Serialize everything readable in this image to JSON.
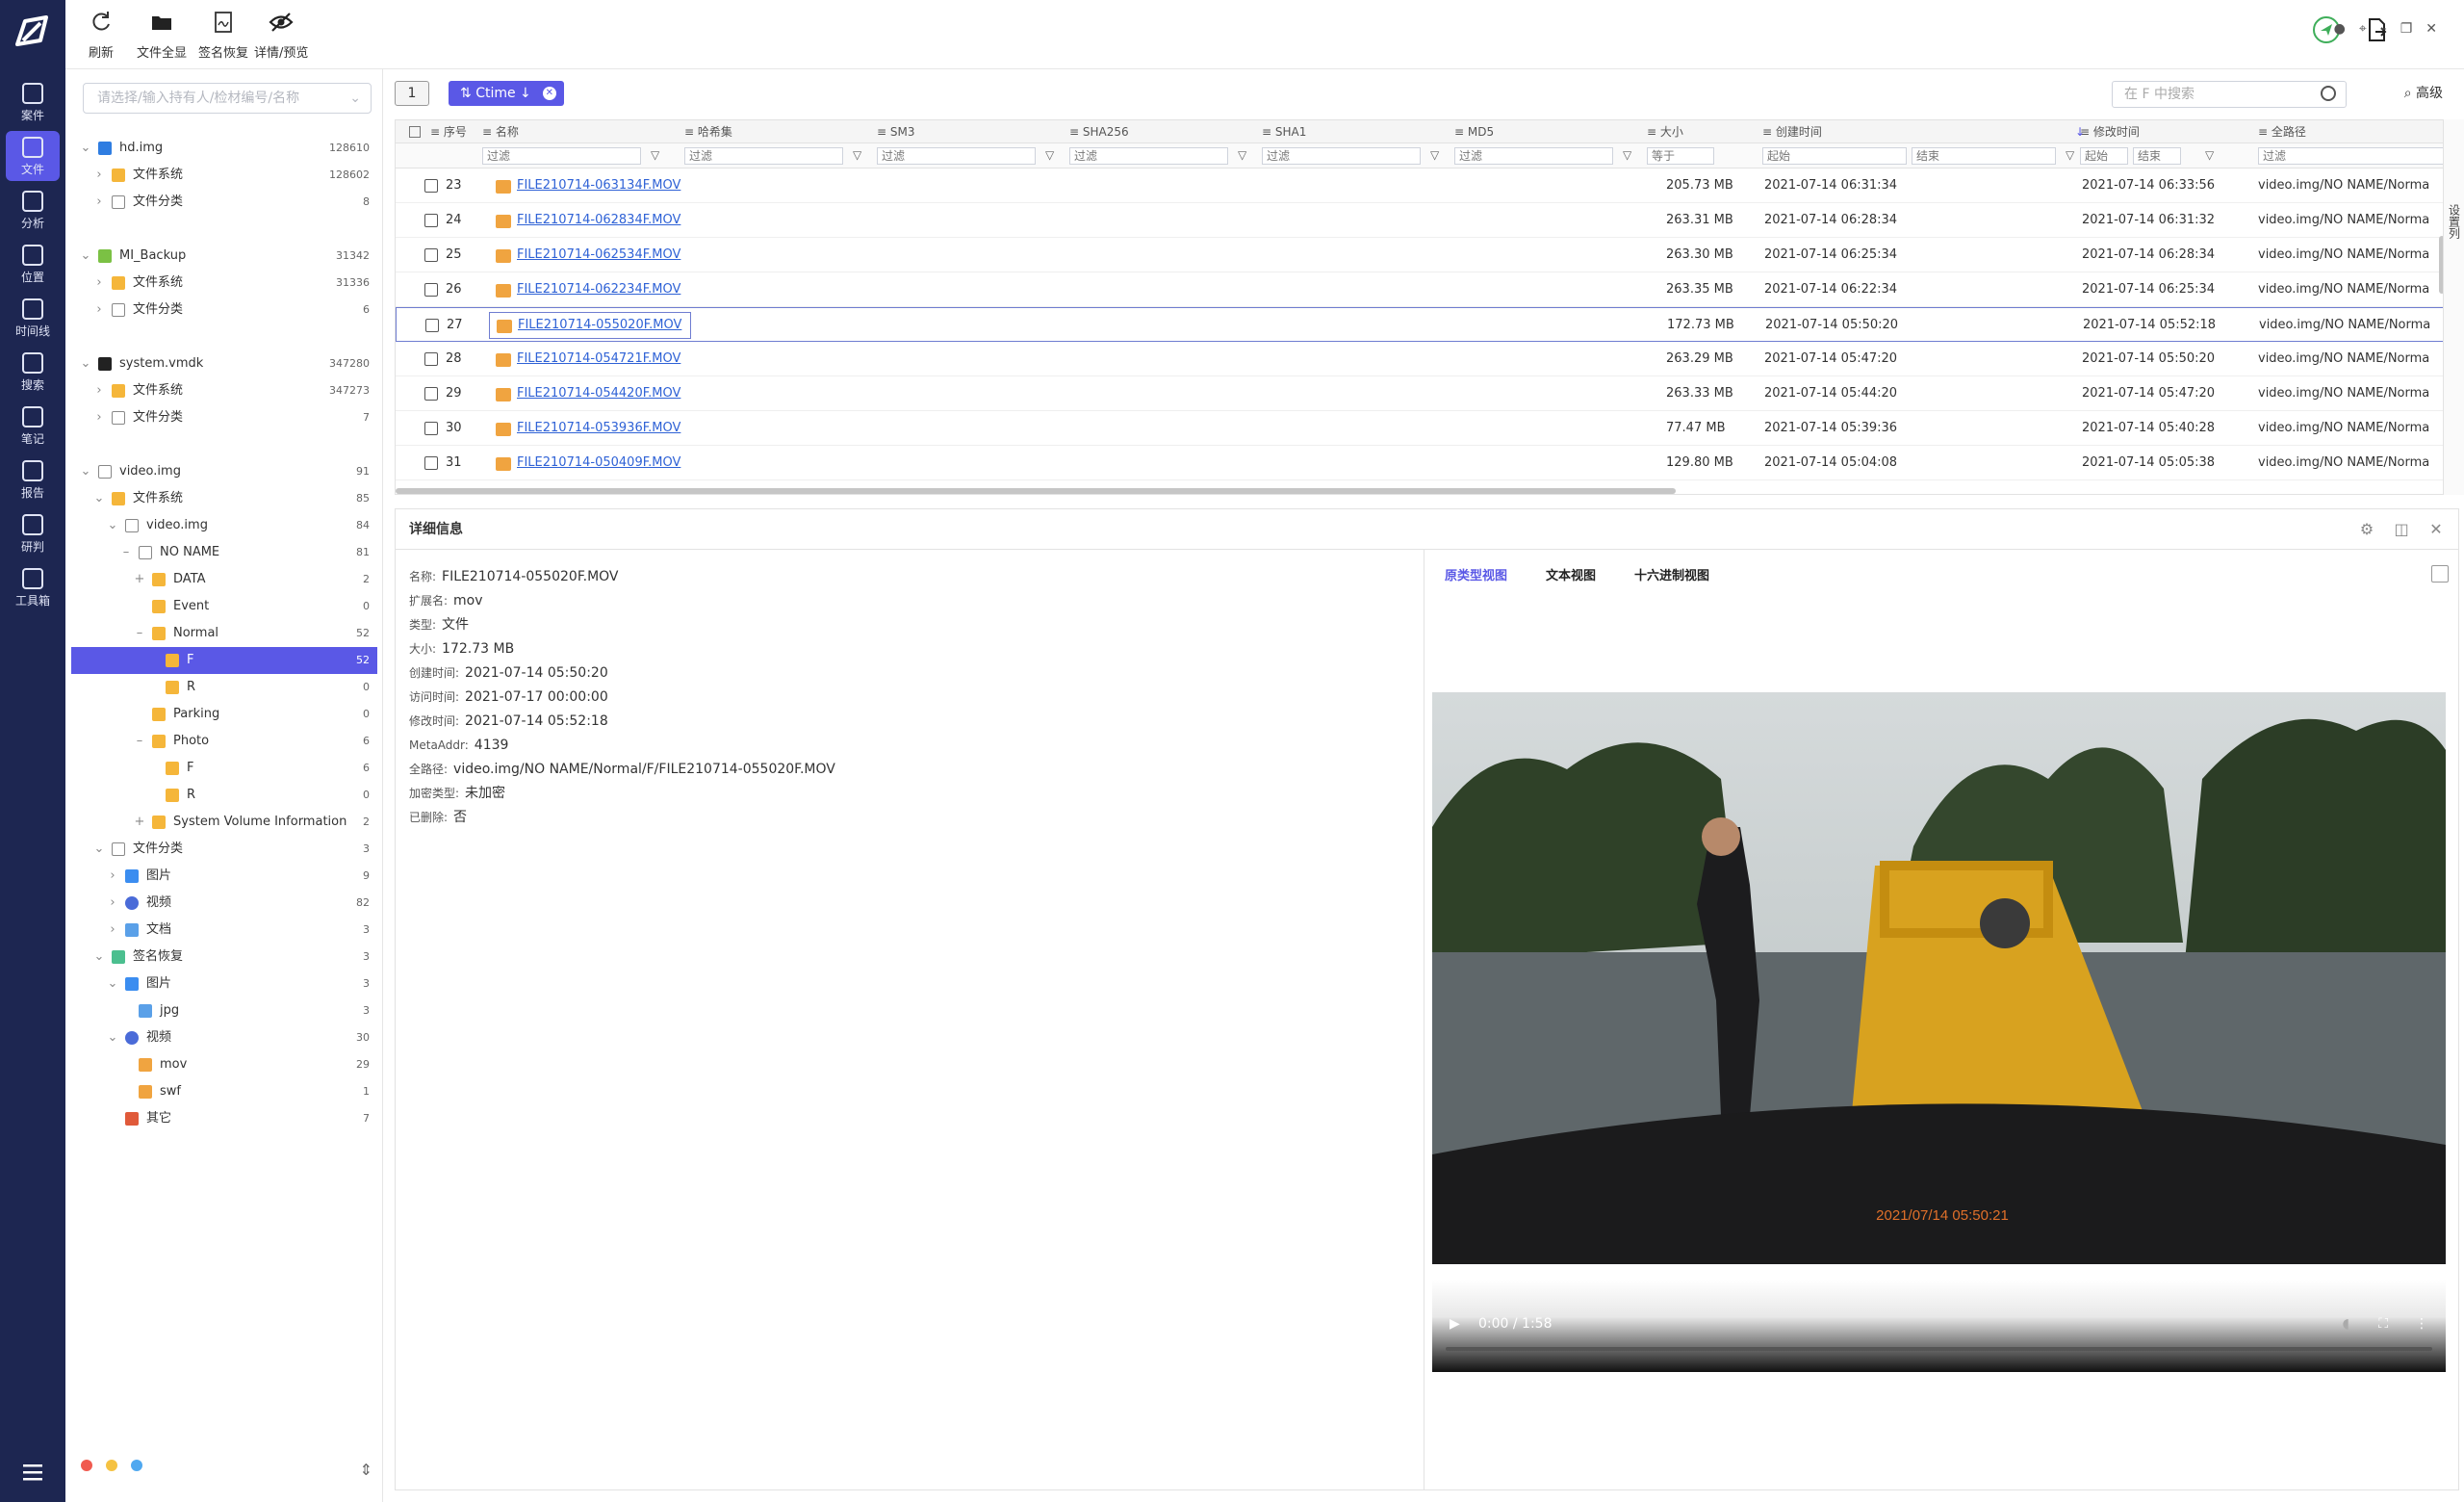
{
  "rail": {
    "items": [
      {
        "label": "案件",
        "icon": "case-icon"
      },
      {
        "label": "文件",
        "icon": "file-icon"
      },
      {
        "label": "分析",
        "icon": "analysis-icon"
      },
      {
        "label": "位置",
        "icon": "location-icon"
      },
      {
        "label": "时间线",
        "icon": "timeline-icon"
      },
      {
        "label": "搜索",
        "icon": "search-icon"
      },
      {
        "label": "笔记",
        "icon": "note-icon"
      },
      {
        "label": "报告",
        "icon": "report-icon"
      },
      {
        "label": "研判",
        "icon": "judge-icon"
      },
      {
        "label": "工具箱",
        "icon": "toolbox-icon"
      }
    ],
    "active_index": 1
  },
  "toolbar": {
    "refresh": "刷新",
    "show_all_files": "文件全显",
    "signature_recovery": "签名恢复",
    "detail_preview": "详情/预览"
  },
  "sidebar": {
    "search_placeholder": "请选择/输入持有人/检材编号/名称",
    "tree": [
      {
        "label": "hd.img",
        "count": "128610",
        "level": 0,
        "arrow": "v",
        "icon": "disk"
      },
      {
        "label": "文件系统",
        "count": "128602",
        "level": 1,
        "arrow": ">",
        "icon": "folder"
      },
      {
        "label": "文件分类",
        "count": "8",
        "level": 1,
        "arrow": ">",
        "icon": "file"
      },
      {
        "label": "",
        "count": "",
        "level": 0,
        "arrow": "",
        "icon": ""
      },
      {
        "label": "MI_Backup",
        "count": "31342",
        "level": 0,
        "arrow": "v",
        "icon": "android"
      },
      {
        "label": "文件系统",
        "count": "31336",
        "level": 1,
        "arrow": ">",
        "icon": "folder"
      },
      {
        "label": "文件分类",
        "count": "6",
        "level": 1,
        "arrow": ">",
        "icon": "file"
      },
      {
        "label": "",
        "count": "",
        "level": 0,
        "arrow": "",
        "icon": ""
      },
      {
        "label": "system.vmdk",
        "count": "347280",
        "level": 0,
        "arrow": "v",
        "icon": "linux"
      },
      {
        "label": "文件系统",
        "count": "347273",
        "level": 1,
        "arrow": ">",
        "icon": "folder"
      },
      {
        "label": "文件分类",
        "count": "7",
        "level": 1,
        "arrow": ">",
        "icon": "file"
      },
      {
        "label": "",
        "count": "",
        "level": 0,
        "arrow": "",
        "icon": ""
      },
      {
        "label": "video.img",
        "count": "91",
        "level": 0,
        "arrow": "v",
        "icon": "file"
      },
      {
        "label": "文件系统",
        "count": "85",
        "level": 1,
        "arrow": "v",
        "icon": "folder"
      },
      {
        "label": "video.img",
        "count": "84",
        "level": 2,
        "arrow": "v",
        "icon": "file"
      },
      {
        "label": "NO NAME",
        "count": "81",
        "level": 3,
        "arrow": "–",
        "icon": "file"
      },
      {
        "label": "DATA",
        "count": "2",
        "level": 4,
        "arrow": "+",
        "icon": "folder"
      },
      {
        "label": "Event",
        "count": "0",
        "level": 4,
        "arrow": "",
        "icon": "folder"
      },
      {
        "label": "Normal",
        "count": "52",
        "level": 4,
        "arrow": "–",
        "icon": "folder"
      },
      {
        "label": "F",
        "count": "52",
        "level": 5,
        "arrow": "",
        "icon": "folder",
        "selected": true
      },
      {
        "label": "R",
        "count": "0",
        "level": 5,
        "arrow": "",
        "icon": "folder"
      },
      {
        "label": "Parking",
        "count": "0",
        "level": 4,
        "arrow": "",
        "icon": "folder"
      },
      {
        "label": "Photo",
        "count": "6",
        "level": 4,
        "arrow": "–",
        "icon": "folder"
      },
      {
        "label": "F",
        "count": "6",
        "level": 5,
        "arrow": "",
        "icon": "folder"
      },
      {
        "label": "R",
        "count": "0",
        "level": 5,
        "arrow": "",
        "icon": "folder"
      },
      {
        "label": "System Volume Information",
        "count": "2",
        "level": 4,
        "arrow": "+",
        "icon": "folder"
      },
      {
        "label": "文件分类",
        "count": "3",
        "level": 1,
        "arrow": "v",
        "icon": "file"
      },
      {
        "label": "图片",
        "count": "9",
        "level": 2,
        "arrow": ">",
        "icon": "img-blue"
      },
      {
        "label": "视频",
        "count": "82",
        "level": 2,
        "arrow": ">",
        "icon": "vid-blue"
      },
      {
        "label": "文档",
        "count": "3",
        "level": 2,
        "arrow": ">",
        "icon": "doc-blue"
      },
      {
        "label": "签名恢复",
        "count": "3",
        "level": 1,
        "arrow": "v",
        "icon": "sig"
      },
      {
        "label": "图片",
        "count": "3",
        "level": 2,
        "arrow": "v",
        "icon": "img-blue"
      },
      {
        "label": "jpg",
        "count": "3",
        "level": 3,
        "arrow": "",
        "icon": "jpg"
      },
      {
        "label": "视频",
        "count": "30",
        "level": 2,
        "arrow": "v",
        "icon": "vid-blue"
      },
      {
        "label": "mov",
        "count": "29",
        "level": 3,
        "arrow": "",
        "icon": "mov"
      },
      {
        "label": "swf",
        "count": "1",
        "level": 3,
        "arrow": "",
        "icon": "mov"
      },
      {
        "label": "其它",
        "count": "7",
        "level": 2,
        "arrow": "",
        "icon": "other"
      }
    ],
    "dot_colors": [
      "#f05a4f",
      "#f5c242",
      "#4fa8f0"
    ]
  },
  "main": {
    "view_toggle": "1",
    "sort_tag": "Ctime",
    "search_placeholder": "在 F 中搜索",
    "advanced": "高级",
    "side_tab": "设置列"
  },
  "grid": {
    "columns": [
      "序号",
      "名称",
      "哈希集",
      "SM3",
      "SHA256",
      "SHA1",
      "MD5",
      "大小",
      "创建时间",
      "修改时间",
      "全路径"
    ],
    "filter_placeholder": "过滤",
    "size_op": "等于",
    "start": "起始",
    "end": "结束",
    "rows": [
      {
        "n": "23",
        "name": "FILE210714-063134F.MOV",
        "size": "205.73 MB",
        "ctime": "2021-07-14 06:31:34",
        "mtime": "2021-07-14 06:33:56",
        "path": "video.img/NO NAME/Norma"
      },
      {
        "n": "24",
        "name": "FILE210714-062834F.MOV",
        "size": "263.31 MB",
        "ctime": "2021-07-14 06:28:34",
        "mtime": "2021-07-14 06:31:32",
        "path": "video.img/NO NAME/Norma"
      },
      {
        "n": "25",
        "name": "FILE210714-062534F.MOV",
        "size": "263.30 MB",
        "ctime": "2021-07-14 06:25:34",
        "mtime": "2021-07-14 06:28:34",
        "path": "video.img/NO NAME/Norma"
      },
      {
        "n": "26",
        "name": "FILE210714-062234F.MOV",
        "size": "263.35 MB",
        "ctime": "2021-07-14 06:22:34",
        "mtime": "2021-07-14 06:25:34",
        "path": "video.img/NO NAME/Norma"
      },
      {
        "n": "27",
        "name": "FILE210714-055020F.MOV",
        "size": "172.73 MB",
        "ctime": "2021-07-14 05:50:20",
        "mtime": "2021-07-14 05:52:18",
        "path": "video.img/NO NAME/Norma",
        "current": true
      },
      {
        "n": "28",
        "name": "FILE210714-054721F.MOV",
        "size": "263.29 MB",
        "ctime": "2021-07-14 05:47:20",
        "mtime": "2021-07-14 05:50:20",
        "path": "video.img/NO NAME/Norma"
      },
      {
        "n": "29",
        "name": "FILE210714-054420F.MOV",
        "size": "263.33 MB",
        "ctime": "2021-07-14 05:44:20",
        "mtime": "2021-07-14 05:47:20",
        "path": "video.img/NO NAME/Norma"
      },
      {
        "n": "30",
        "name": "FILE210714-053936F.MOV",
        "size": "77.47 MB",
        "ctime": "2021-07-14 05:39:36",
        "mtime": "2021-07-14 05:40:28",
        "path": "video.img/NO NAME/Norma"
      },
      {
        "n": "31",
        "name": "FILE210714-050409F.MOV",
        "size": "129.80 MB",
        "ctime": "2021-07-14 05:04:08",
        "mtime": "2021-07-14 05:05:38",
        "path": "video.img/NO NAME/Norma"
      }
    ]
  },
  "detail": {
    "title": "详细信息",
    "props": [
      {
        "k": "名称:",
        "v": "FILE210714-055020F.MOV"
      },
      {
        "k": "扩展名:",
        "v": "mov"
      },
      {
        "k": "类型:",
        "v": "文件"
      },
      {
        "k": "大小:",
        "v": "172.73 MB"
      },
      {
        "k": "创建时间:",
        "v": "2021-07-14 05:50:20"
      },
      {
        "k": "访问时间:",
        "v": "2021-07-17 00:00:00"
      },
      {
        "k": "修改时间:",
        "v": "2021-07-14 05:52:18"
      },
      {
        "k": "MetaAddr:",
        "v": "4139"
      },
      {
        "k": "全路径:",
        "v": "video.img/NO NAME/Normal/F/FILE210714-055020F.MOV"
      },
      {
        "k": "加密类型:",
        "v": "未加密"
      },
      {
        "k": "已删除:",
        "v": "否"
      }
    ],
    "tabs": [
      "原类型视图",
      "文本视图",
      "十六进制视图"
    ],
    "video_timestamp": "2021/07/14 05:50:21",
    "video_time": "0:00 / 1:58"
  },
  "colors": {
    "accent": "#5a58e6",
    "rail": "#1d2651",
    "link": "#2f62d6"
  }
}
